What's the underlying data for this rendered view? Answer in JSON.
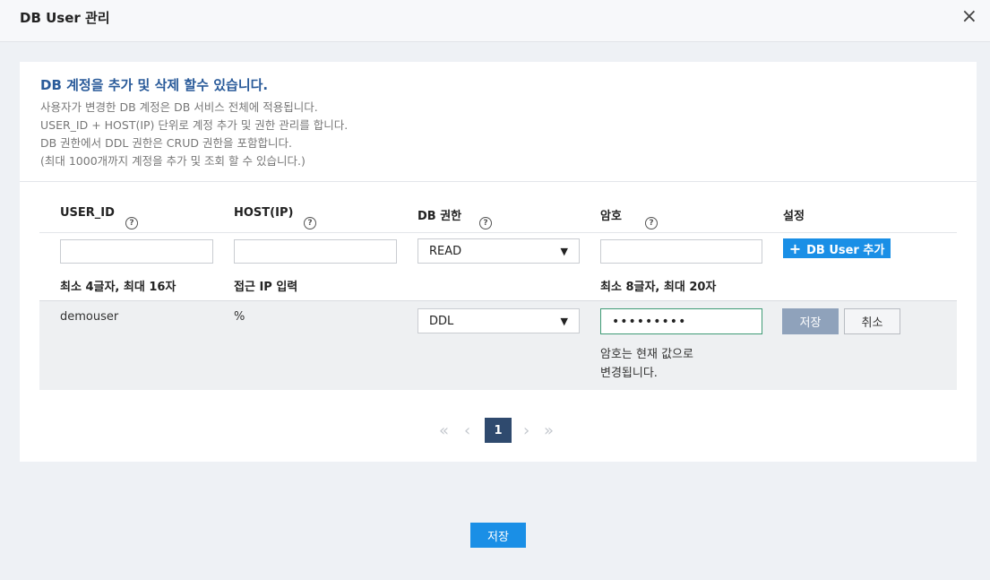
{
  "dialog": {
    "title": "DB User 관리",
    "close_glyph": "×"
  },
  "info": {
    "headline": "DB 계정을 추가 및 삭제 할수 있습니다.",
    "lines": [
      "사용자가 변경한 DB 계정은 DB 서비스 전체에 적용됩니다.",
      "USER_ID + HOST(IP) 단위로 계정 추가 및 권한 관리를 합니다.",
      "DB 권한에서 DDL 권한은 CRUD 권한을 포함합니다.",
      "(최대 1000개까지 계정을 추가 및 조회 할 수 있습니다.)"
    ]
  },
  "table": {
    "headers": {
      "user_id": "USER_ID",
      "host": "HOST(IP)",
      "db_perm": "DB 권한",
      "password": "암호",
      "settings": "설정"
    },
    "help_glyph": "?",
    "new_row": {
      "user_id_value": "",
      "host_value": "",
      "perm_value": "READ",
      "password_value": "",
      "add_button_label": "DB User 추가",
      "add_icon": "+"
    },
    "hints": {
      "user_id": "최소 4글자, 최대 16자",
      "host": "접근 IP 입력",
      "password": "최소 8글자, 최대 20자"
    },
    "rows": [
      {
        "user_id": "demouser",
        "host": "%",
        "perm": "DDL",
        "password_masked": "•••••••••",
        "password_note_1": "암호는 현재 값으로",
        "password_note_2": "변경됩니다.",
        "save_label": "저장",
        "cancel_label": "취소"
      }
    ]
  },
  "pager": {
    "first": "«",
    "prev": "‹",
    "current": "1",
    "next": "›",
    "last": "»"
  },
  "footer": {
    "save_label": "저장"
  },
  "colors": {
    "accent": "#1a8fe6",
    "headline": "#2a5b9a",
    "pager_active": "#2f4a6e"
  }
}
